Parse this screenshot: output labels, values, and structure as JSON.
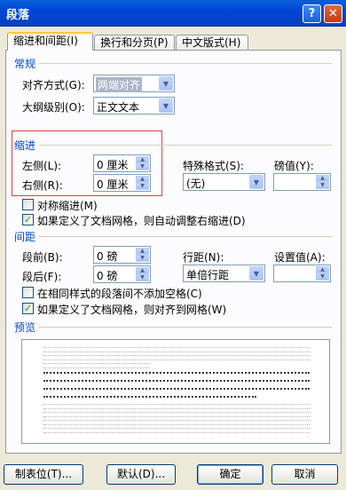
{
  "window": {
    "title": "段落",
    "help": "?",
    "close": "✕"
  },
  "tabs": [
    {
      "label": "缩进和间距(I)"
    },
    {
      "label": "换行和分页(P)"
    },
    {
      "label": "中文版式(H)"
    }
  ],
  "general": {
    "heading": "常规",
    "align_label": "对齐方式(G):",
    "align_value": "两端对齐",
    "outline_label": "大纲级别(O):",
    "outline_value": "正文文本"
  },
  "indent": {
    "heading": "缩进",
    "left_label": "左侧(L):",
    "left_value": "0 厘米",
    "right_label": "右侧(R):",
    "right_value": "0 厘米",
    "special_label": "特殊格式(S):",
    "special_value": "(无)",
    "amount_label": "磅值(Y):",
    "amount_value": "",
    "mirror_label": "对称缩进(M)",
    "mirror_checked": false,
    "auto_label": "如果定义了文档网格，则自动调整右缩进(D)",
    "auto_checked": true
  },
  "spacing": {
    "heading": "间距",
    "before_label": "段前(B):",
    "before_value": "0 磅",
    "after_label": "段后(F):",
    "after_value": "0 磅",
    "line_label": "行距(N):",
    "line_value": "单倍行距",
    "at_label": "设置值(A):",
    "at_value": "",
    "nospace_label": "在相同样式的段落间不添加空格(C)",
    "nospace_checked": false,
    "snap_label": "如果定义了文档网格，则对齐到网格(W)",
    "snap_checked": true
  },
  "preview": {
    "heading": "预览"
  },
  "buttons": {
    "tabs": "制表位(T)...",
    "default": "默认(D)...",
    "ok": "确定",
    "cancel": "取消"
  },
  "icons": {
    "dropdown": "dropdown-arrow-icon",
    "spinner": "spinner-icon",
    "check": "checkmark-icon"
  }
}
